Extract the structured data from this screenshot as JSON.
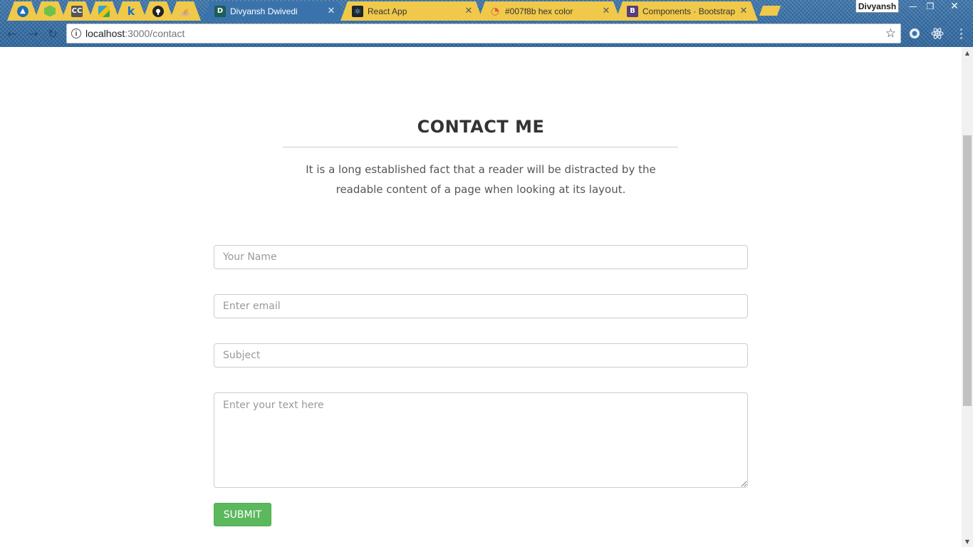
{
  "browser": {
    "pinned_tabs": [
      {
        "icon": "bird-icon",
        "color": "#1f6fb2"
      },
      {
        "icon": "node-hexagon-icon",
        "color": "#6cc24a"
      },
      {
        "icon": "cc-icon",
        "color": "#555555",
        "glyph": "CC"
      },
      {
        "icon": "drive-icon",
        "color": "#2ea3d6"
      },
      {
        "icon": "k-icon",
        "color": "#1a73c9",
        "glyph": "k"
      },
      {
        "icon": "github-icon",
        "color": "#222222"
      },
      {
        "icon": "stack-overflow-icon",
        "color": "#f48024"
      }
    ],
    "tabs": [
      {
        "title": "Divyansh Dwivedi",
        "favicon": "D",
        "favicon_color": "#1b5e54",
        "active": true
      },
      {
        "title": "React App",
        "favicon": "⚛",
        "favicon_color": "#20232a",
        "active": false
      },
      {
        "title": "#007f8b hex color",
        "favicon": "◔",
        "favicon_color": "#e05a3a",
        "active": false
      },
      {
        "title": "Components · Bootstrap",
        "favicon": "B",
        "favicon_color": "#563d7c",
        "active": false
      }
    ],
    "profile_name": "Divyansh",
    "url_host": "localhost",
    "url_path": ":3000/contact",
    "accent_green": "#5cb85c"
  },
  "contact": {
    "heading": "CONTACT ME",
    "description": "It is a long established fact that a reader will be distracted by the readable content of a page when looking at its layout.",
    "name_placeholder": "Your Name",
    "email_placeholder": "Enter email",
    "subject_placeholder": "Subject",
    "message_placeholder": "Enter your text here",
    "submit_label": "SUBMIT"
  }
}
